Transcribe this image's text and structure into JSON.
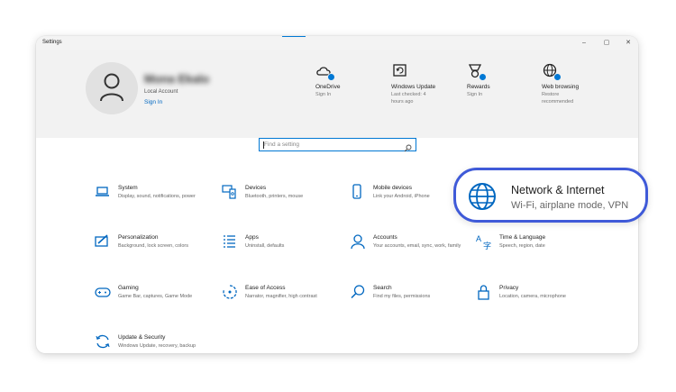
{
  "window": {
    "title": "Settings",
    "controls": {
      "minimize": "–",
      "maximize": "▢",
      "close": "✕"
    }
  },
  "account": {
    "name": "Mona Ekalo",
    "type": "Local Account",
    "sign_in": "Sign In"
  },
  "header_items": [
    {
      "icon": "onedrive-icon",
      "label": "OneDrive",
      "sub": "Sign In"
    },
    {
      "icon": "windows-update-icon",
      "label": "Windows Update",
      "sub": "Last checked: 4\nhours ago"
    },
    {
      "icon": "rewards-icon",
      "label": "Rewards",
      "sub": "Sign In"
    },
    {
      "icon": "web-browsing-icon",
      "label": "Web browsing",
      "sub": "Restore\nrecommended"
    }
  ],
  "search": {
    "placeholder": "Find a setting"
  },
  "categories": [
    {
      "icon": "laptop-icon",
      "name": "System",
      "desc": "Display, sound, notifications, power"
    },
    {
      "icon": "devices-icon",
      "name": "Devices",
      "desc": "Bluetooth, printers, mouse"
    },
    {
      "icon": "phone-icon",
      "name": "Mobile devices",
      "desc": "Link your Android, iPhone"
    },
    {
      "icon": "globe-icon",
      "name": "Network & Internet",
      "desc": "Wi-Fi, airplane mode, VPN"
    },
    {
      "icon": "personalization-icon",
      "name": "Personalization",
      "desc": "Background, lock screen, colors"
    },
    {
      "icon": "apps-icon",
      "name": "Apps",
      "desc": "Uninstall, defaults"
    },
    {
      "icon": "person-icon",
      "name": "Accounts",
      "desc": "Your accounts, email, sync, work, family"
    },
    {
      "icon": "language-icon",
      "name": "Time & Language",
      "desc": "Speech, region, date"
    },
    {
      "icon": "gamepad-icon",
      "name": "Gaming",
      "desc": "Game Bar, captures, Game Mode"
    },
    {
      "icon": "ease-of-access-icon",
      "name": "Ease of Access",
      "desc": "Narrator, magnifier, high contrast"
    },
    {
      "icon": "search-icon",
      "name": "Search",
      "desc": "Find my files, permissions"
    },
    {
      "icon": "lock-icon",
      "name": "Privacy",
      "desc": "Location, camera, microphone"
    },
    {
      "icon": "update-icon",
      "name": "Update & Security",
      "desc": "Windows Update, recovery, backup"
    }
  ],
  "colors": {
    "accent": "#0078d4",
    "callout_border": "#3f5ad8",
    "header_bg": "#f2f2f2"
  }
}
